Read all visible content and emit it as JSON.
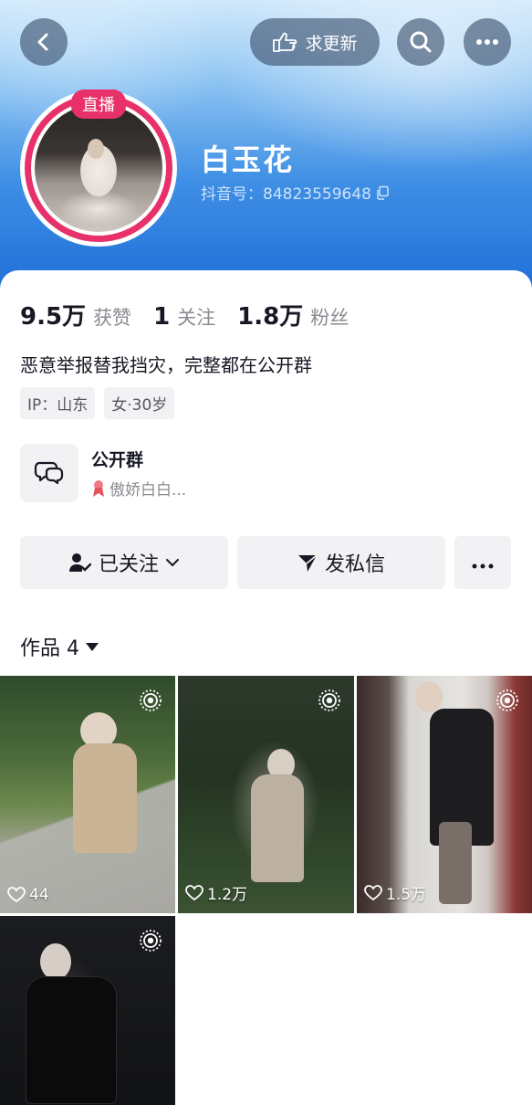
{
  "header": {
    "update_request_label": "求更新",
    "live_badge": "直播",
    "name": "白玉花",
    "douyin_id": "抖音号：84823559648"
  },
  "stats": {
    "likes_value": "9.5万",
    "likes_label": "获赞",
    "following_value": "1",
    "following_label": "关注",
    "followers_value": "1.8万",
    "followers_label": "粉丝"
  },
  "bio": "恶意举报替我挡灾，完整都在公开群",
  "tags": [
    "IP：山东",
    "女·30岁"
  ],
  "group": {
    "title": "公开群",
    "subtitle": "傲娇白白..."
  },
  "actions": {
    "following_label": "已关注",
    "message_label": "发私信"
  },
  "works_tab": "作品 4",
  "works": [
    {
      "likes": "44"
    },
    {
      "likes": "1.2万"
    },
    {
      "likes": "1.5万"
    },
    {
      "likes": ""
    }
  ],
  "colors": {
    "live_accent": "#e8316b",
    "banner_blue": "#1f6fd8",
    "button_bg": "#f2f2f4",
    "muted_text": "#8a8b91"
  },
  "icons": {
    "back": "chevron-left-icon",
    "update": "pointing-hand-icon",
    "search": "search-icon",
    "more": "more-dots-icon",
    "copy": "copy-icon",
    "group": "chat-bubbles-icon",
    "ribbon": "ribbon-icon",
    "followed": "user-check-icon",
    "message": "send-icon",
    "caret": "caret-down-icon",
    "heart": "heart-outline-icon",
    "live": "live-target-icon"
  }
}
